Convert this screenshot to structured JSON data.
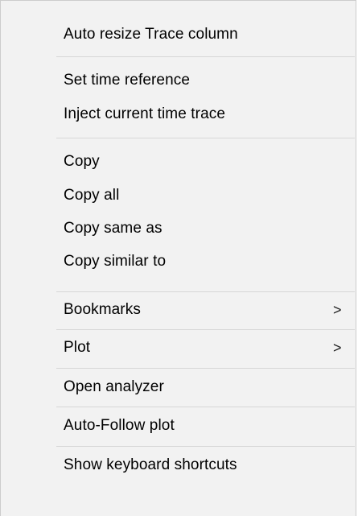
{
  "menu": {
    "items": [
      {
        "label": "Auto resize Trace column"
      },
      {
        "label": "Set time reference"
      },
      {
        "label": "Inject current time trace"
      },
      {
        "label": "Copy"
      },
      {
        "label": "Copy all"
      },
      {
        "label": "Copy same as"
      },
      {
        "label": "Copy similar to"
      },
      {
        "label": "Bookmarks",
        "submenu": ">"
      },
      {
        "label": "Plot",
        "submenu": ">"
      },
      {
        "label": "Open analyzer"
      },
      {
        "label": "Auto-Follow plot"
      },
      {
        "label": "Show keyboard shortcuts"
      }
    ]
  }
}
